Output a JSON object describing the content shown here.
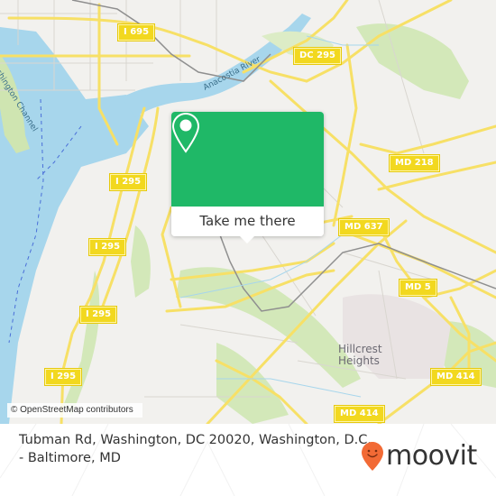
{
  "map": {
    "colors": {
      "land": "#f2f1ee",
      "water": "#a7d6ec",
      "park": "#d3e8b9",
      "road_major": "#f7e066",
      "road_minor": "#d9d6d0",
      "rail": "#8f8f8f",
      "accent_green": "#1fb867",
      "moovit_orange": "#f26a35"
    },
    "road_shields": [
      {
        "id": "i695",
        "label": "I 695"
      },
      {
        "id": "dc295",
        "label": "DC 295"
      },
      {
        "id": "md218",
        "label": "MD 218"
      },
      {
        "id": "i295a",
        "label": "I 295"
      },
      {
        "id": "md637",
        "label": "MD 637"
      },
      {
        "id": "i295b",
        "label": "I 295"
      },
      {
        "id": "md5",
        "label": "MD 5"
      },
      {
        "id": "i295c",
        "label": "I 295"
      },
      {
        "id": "i295d",
        "label": "I 295"
      },
      {
        "id": "md414a",
        "label": "MD 414"
      },
      {
        "id": "md414b",
        "label": "MD 414"
      }
    ],
    "water_labels": {
      "channel": "Washington Channel",
      "river": "Anacostia River"
    },
    "place_labels": {
      "hillcrest": "Hillcrest\nHeights"
    },
    "attribution": "© OpenStreetMap contributors"
  },
  "popup": {
    "icon": "map-pin-icon",
    "button_label": "Take me there"
  },
  "footer": {
    "address": "Tubman Rd, Washington, DC 20020, Washington, D.C. - Baltimore, MD",
    "brand": "moovit",
    "brand_icon": "moovit-pin-smile-icon"
  }
}
